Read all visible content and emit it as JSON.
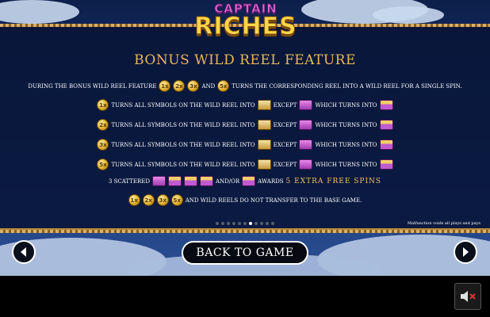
{
  "logo": {
    "line1": "CAPTAIN",
    "line2": "RICHES"
  },
  "title": "BONUS WILD REEL FEATURE",
  "intro": {
    "prefix": "DURING THE BONUS WILD REEL FEATURE",
    "and": "AND",
    "suffix": "TURNS THE CORRESPONDING REEL INTO A WILD REEL FOR A SINGLE SPIN."
  },
  "rows": [
    {
      "coin": "1x",
      "text": "TURNS ALL SYMBOLS ON THE WILD REEL INTO",
      "except": "EXCEPT",
      "which": "WHICH TURNS INTO"
    },
    {
      "coin": "2x",
      "text": "TURNS ALL SYMBOLS ON THE WILD REEL INTO",
      "except": "EXCEPT",
      "which": "WHICH TURNS INTO"
    },
    {
      "coin": "3x",
      "text": "TURNS ALL SYMBOLS ON THE WILD REEL INTO",
      "except": "EXCEPT",
      "which": "WHICH TURNS INTO"
    },
    {
      "coin": "5x",
      "text": "TURNS ALL SYMBOLS ON THE WILD REEL INTO",
      "except": "EXCEPT",
      "which": "WHICH TURNS INTO"
    }
  ],
  "scatter": {
    "prefix": "3 SCATTERED",
    "andor": "AND/OR",
    "awards": "AWARDS",
    "highlight": "5 EXTRA FREE SPINS"
  },
  "note": "AND WILD REELS DO NOT TRANSFER TO THE BASE GAME.",
  "coins": [
    "1x",
    "2x",
    "3x",
    "5x"
  ],
  "disclaimer": "Malfunction voids all plays and pays",
  "pagination": {
    "total": 11,
    "current": 7
  },
  "back_label": "BACK TO GAME",
  "icons": {
    "prev": "left-arrow-icon",
    "next": "right-arrow-icon",
    "sound": "sound-muted-icon"
  },
  "colors": {
    "accent": "#e8b85a",
    "border": "#b88a3c",
    "panel": "#081437"
  }
}
